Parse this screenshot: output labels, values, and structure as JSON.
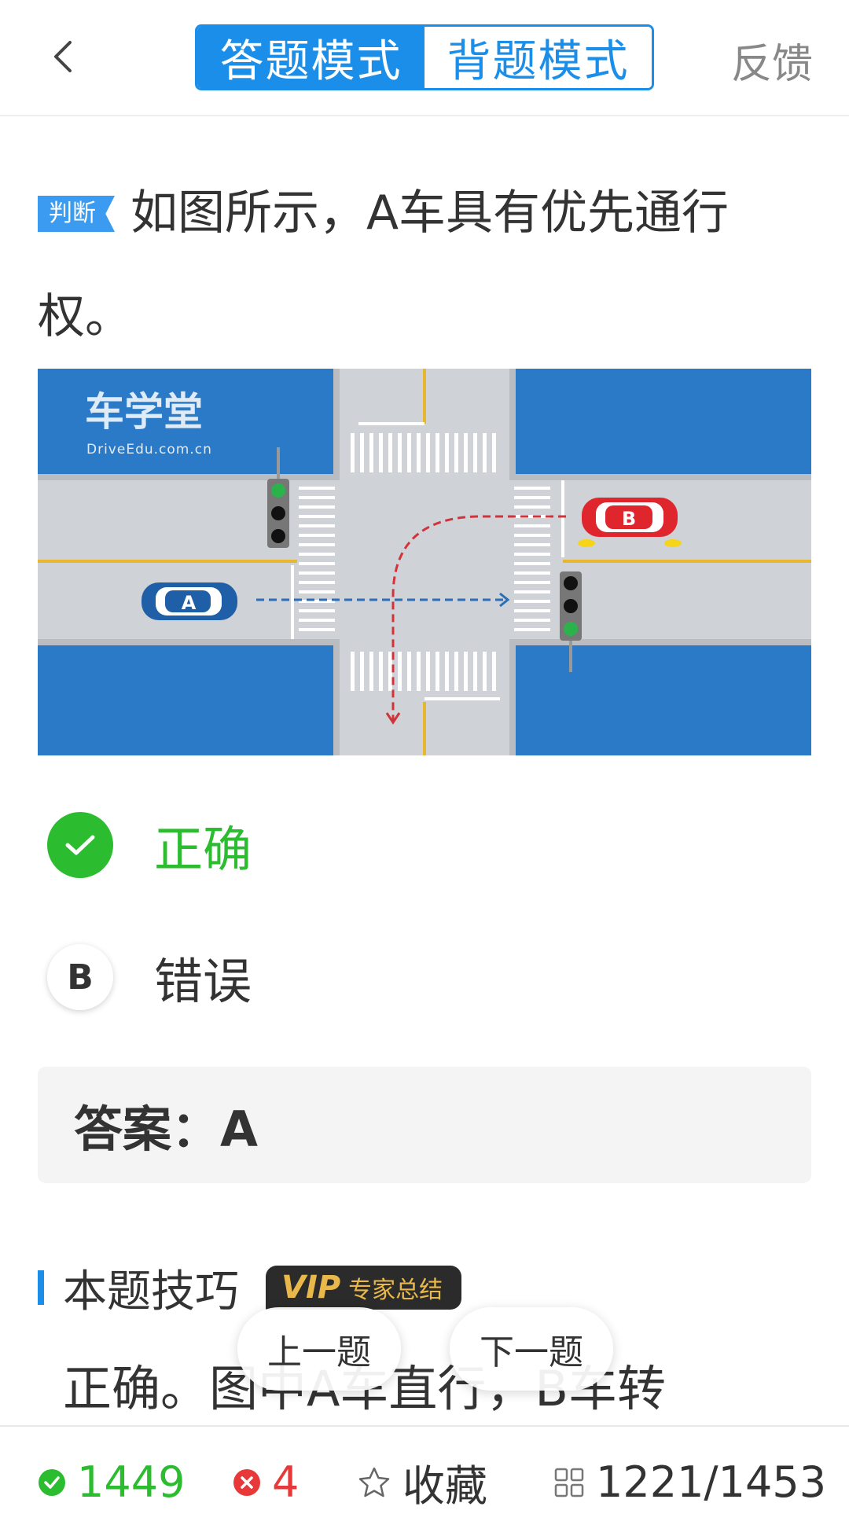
{
  "header": {
    "back_icon": "chevron-left-icon",
    "tabs": [
      {
        "label": "答题模式",
        "active": true
      },
      {
        "label": "背题模式",
        "active": false
      }
    ],
    "feedback_label": "反馈"
  },
  "question": {
    "type_badge": "判断",
    "text": "如图所示，A车具有优先通行权。"
  },
  "figure": {
    "watermark_title": "车学堂",
    "watermark_url": "DriveEdu.com.cn",
    "car_a_label": "A",
    "car_b_label": "B"
  },
  "options": [
    {
      "letter": "A",
      "label": "正确",
      "state": "correct",
      "icon": "check-icon"
    },
    {
      "letter": "B",
      "label": "错误",
      "state": "normal"
    }
  ],
  "answer": {
    "label": "答案：A"
  },
  "tip": {
    "title": "本题技巧",
    "vip_logo": "VIP",
    "vip_text": "专家总结",
    "body": "正确。图中A车直行，B车转"
  },
  "nav": {
    "prev_label": "上一题",
    "next_label": "下一题"
  },
  "bottom_bar": {
    "correct_count": "1449",
    "wrong_count": "4",
    "favorite_label": "收藏",
    "progress": "1221/1453"
  },
  "colors": {
    "accent": "#1a8ee8",
    "correct": "#2bbd2f",
    "wrong": "#e8393a",
    "vip_gold": "#e8b94a"
  }
}
